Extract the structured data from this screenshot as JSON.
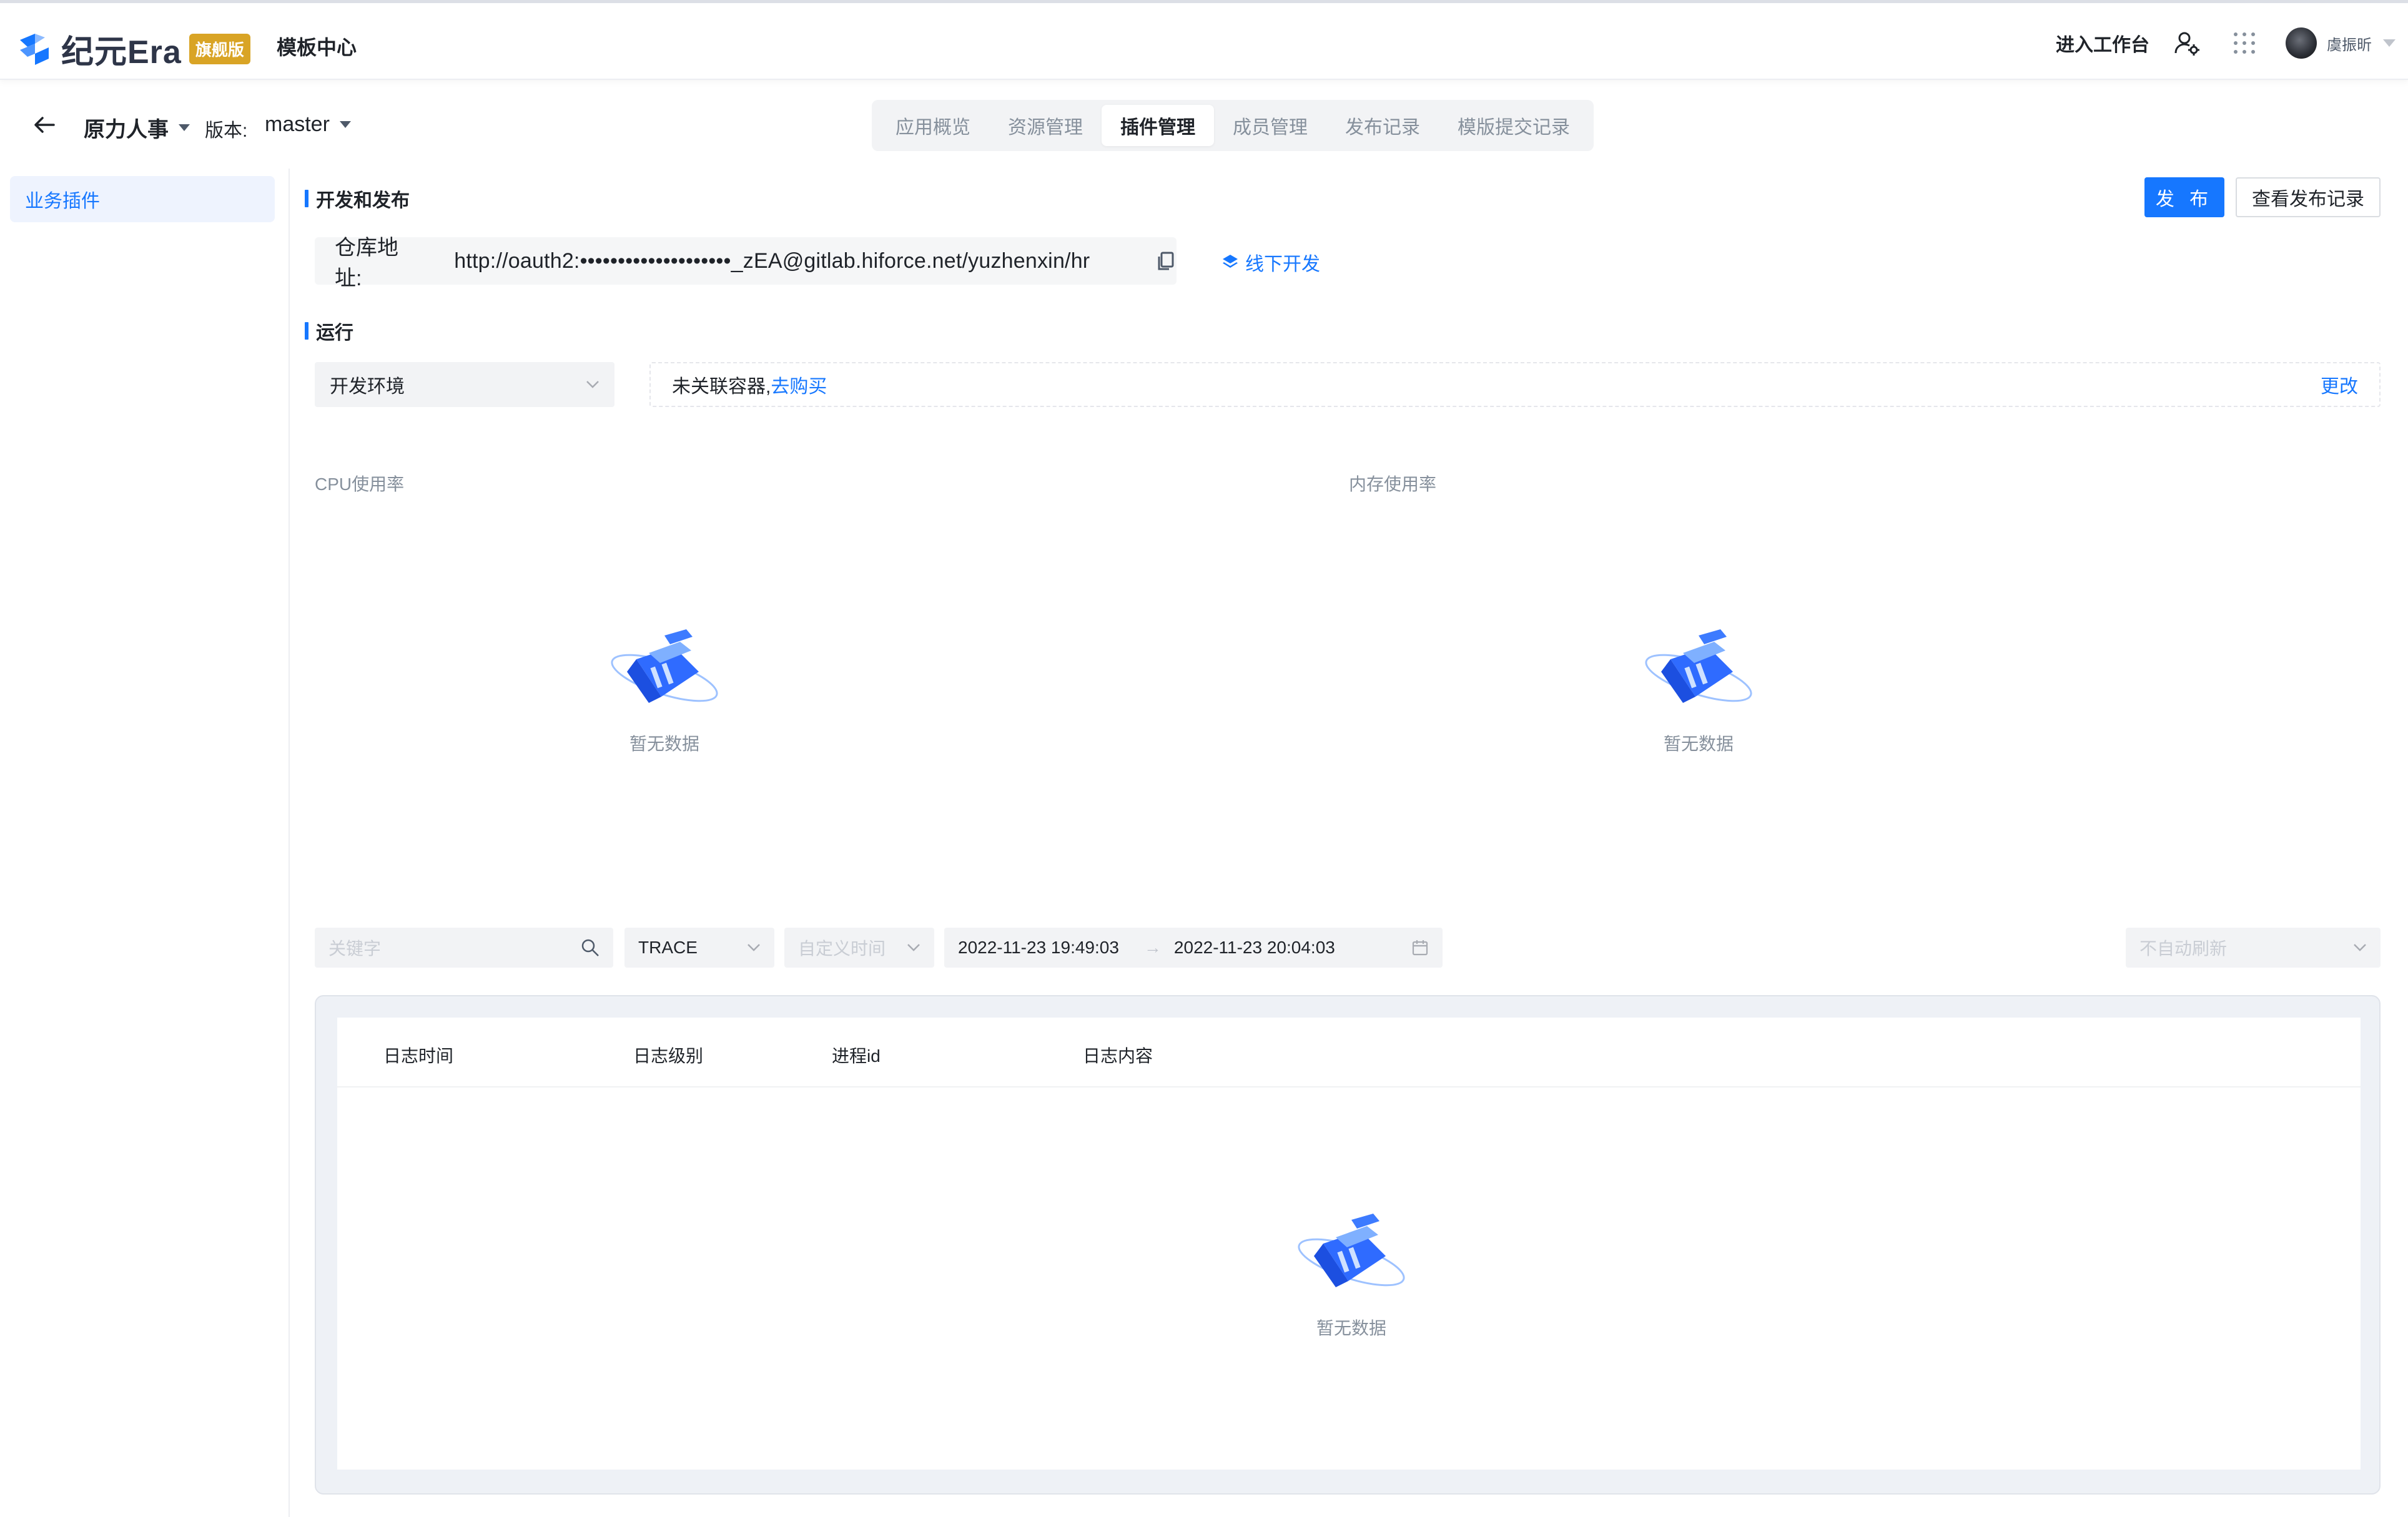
{
  "brand": {
    "name": "纪元Era",
    "badge": "旗舰版",
    "accent": "#1677ff",
    "badge_color": "#d9a425"
  },
  "header": {
    "title": "模板中心",
    "enter_workspace": "进入工作台",
    "user_name": "虞振昕",
    "icons": [
      "user-settings-icon",
      "apps-grid-icon"
    ]
  },
  "subheader": {
    "app_name": "原力人事",
    "version_label": "版本:",
    "version_value": "master",
    "tabs": [
      {
        "label": "应用概览",
        "active": false
      },
      {
        "label": "资源管理",
        "active": false
      },
      {
        "label": "插件管理",
        "active": true
      },
      {
        "label": "成员管理",
        "active": false
      },
      {
        "label": "发布记录",
        "active": false
      },
      {
        "label": "模版提交记录",
        "active": false
      }
    ]
  },
  "sidebar": {
    "items": [
      {
        "label": "业务插件",
        "active": true
      }
    ]
  },
  "dev_section": {
    "title": "开发和发布",
    "publish_label": "发 布",
    "history_label": "查看发布记录",
    "repo_label": "仓库地址:",
    "repo_url": "http://oauth2:••••••••••••••••••••_zEA@gitlab.hiforce.net/yuzhenxin/hr",
    "offline_dev": "线下开发"
  },
  "run_section": {
    "title": "运行",
    "env_value": "开发环境",
    "container_text": "未关联容器,",
    "buy_link": "去购买",
    "change_link": "更改"
  },
  "charts": {
    "cpu_label": "CPU使用率",
    "mem_label": "内存使用率",
    "empty_text": "暂无数据"
  },
  "log_filters": {
    "keyword_placeholder": "关键字",
    "level_value": "TRACE",
    "time_mode_placeholder": "自定义时间",
    "start_time": "2022-11-23 19:49:03",
    "range_arrow": "→",
    "end_time": "2022-11-23 20:04:03",
    "refresh_placeholder": "不自动刷新"
  },
  "log_table": {
    "columns": [
      "日志时间",
      "日志级别",
      "进程id",
      "日志内容"
    ],
    "rows": [],
    "empty_text": "暂无数据"
  }
}
